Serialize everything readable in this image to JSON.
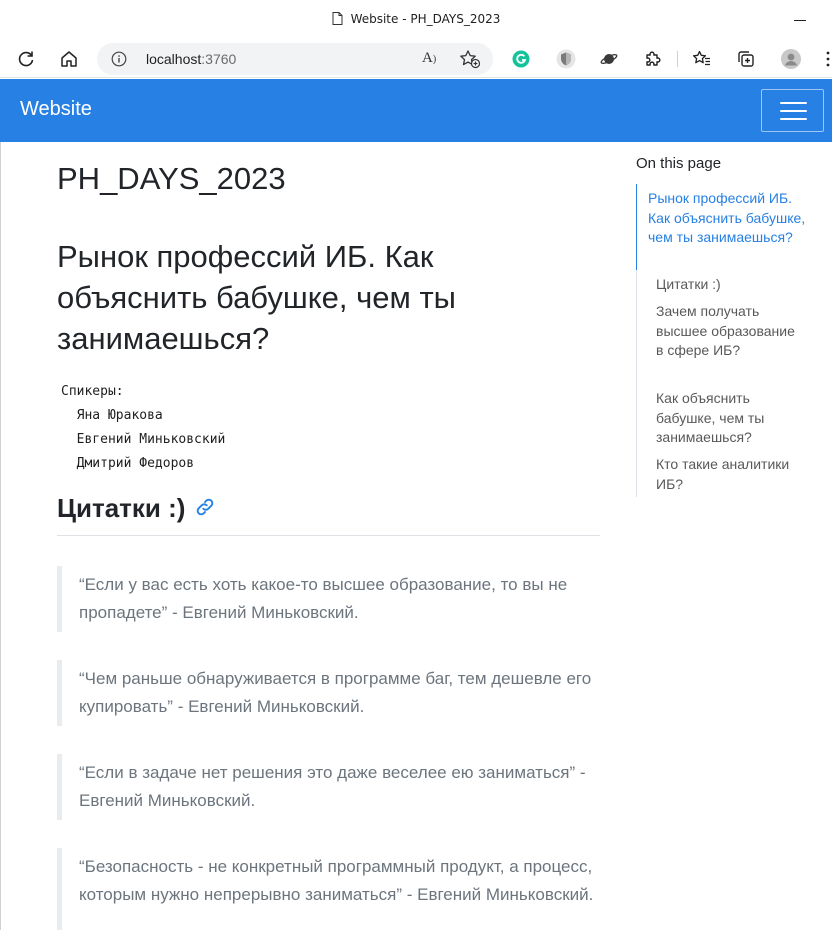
{
  "browser": {
    "window_title": "Website - PH_DAYS_2023",
    "address": {
      "host": "localhost",
      "port": ":3760"
    }
  },
  "navbar": {
    "brand": "Website"
  },
  "main": {
    "page_title": "PH_DAYS_2023",
    "talk_title": "Рынок профессий ИБ. Как объяснить бабушке, чем ты занимаешься?",
    "speakers_text": "Спикеры:\n  Яна Юракова\n  Евгений Миньковский\n  Дмитрий Федоров",
    "section_heading": "Цитатки :)",
    "quotes": [
      "“Если у вас есть хоть какое-то высшее образование, то вы не пропадете” - Евгений Миньковский.",
      "“Чем раньше обнаруживается в программе баг, тем дешевле его купировать” - Евгений Миньковский.",
      "“Если в задаче нет решения это даже веселее ею заниматься” - Евгений Миньковский.",
      "“Безопасность - не конкретный программный продукт, а процесс, которым нужно непрерывно заниматься” - Евгений Миньковский."
    ]
  },
  "toc": {
    "heading": "On this page",
    "items": [
      "Рынок профессий ИБ. Как объяснить бабушке, чем ты занимаешься?",
      "Цитатки :)",
      "Зачем получать высшее образование в сфере ИБ?",
      "Как объяснить бабушке, чем ты занимаешься?",
      "Кто такие аналитики ИБ?"
    ]
  },
  "colors": {
    "navbar_bg": "#2780e3",
    "link": "#2780e3",
    "quote_text": "#6c757d",
    "quote_border": "#e9ecef"
  }
}
